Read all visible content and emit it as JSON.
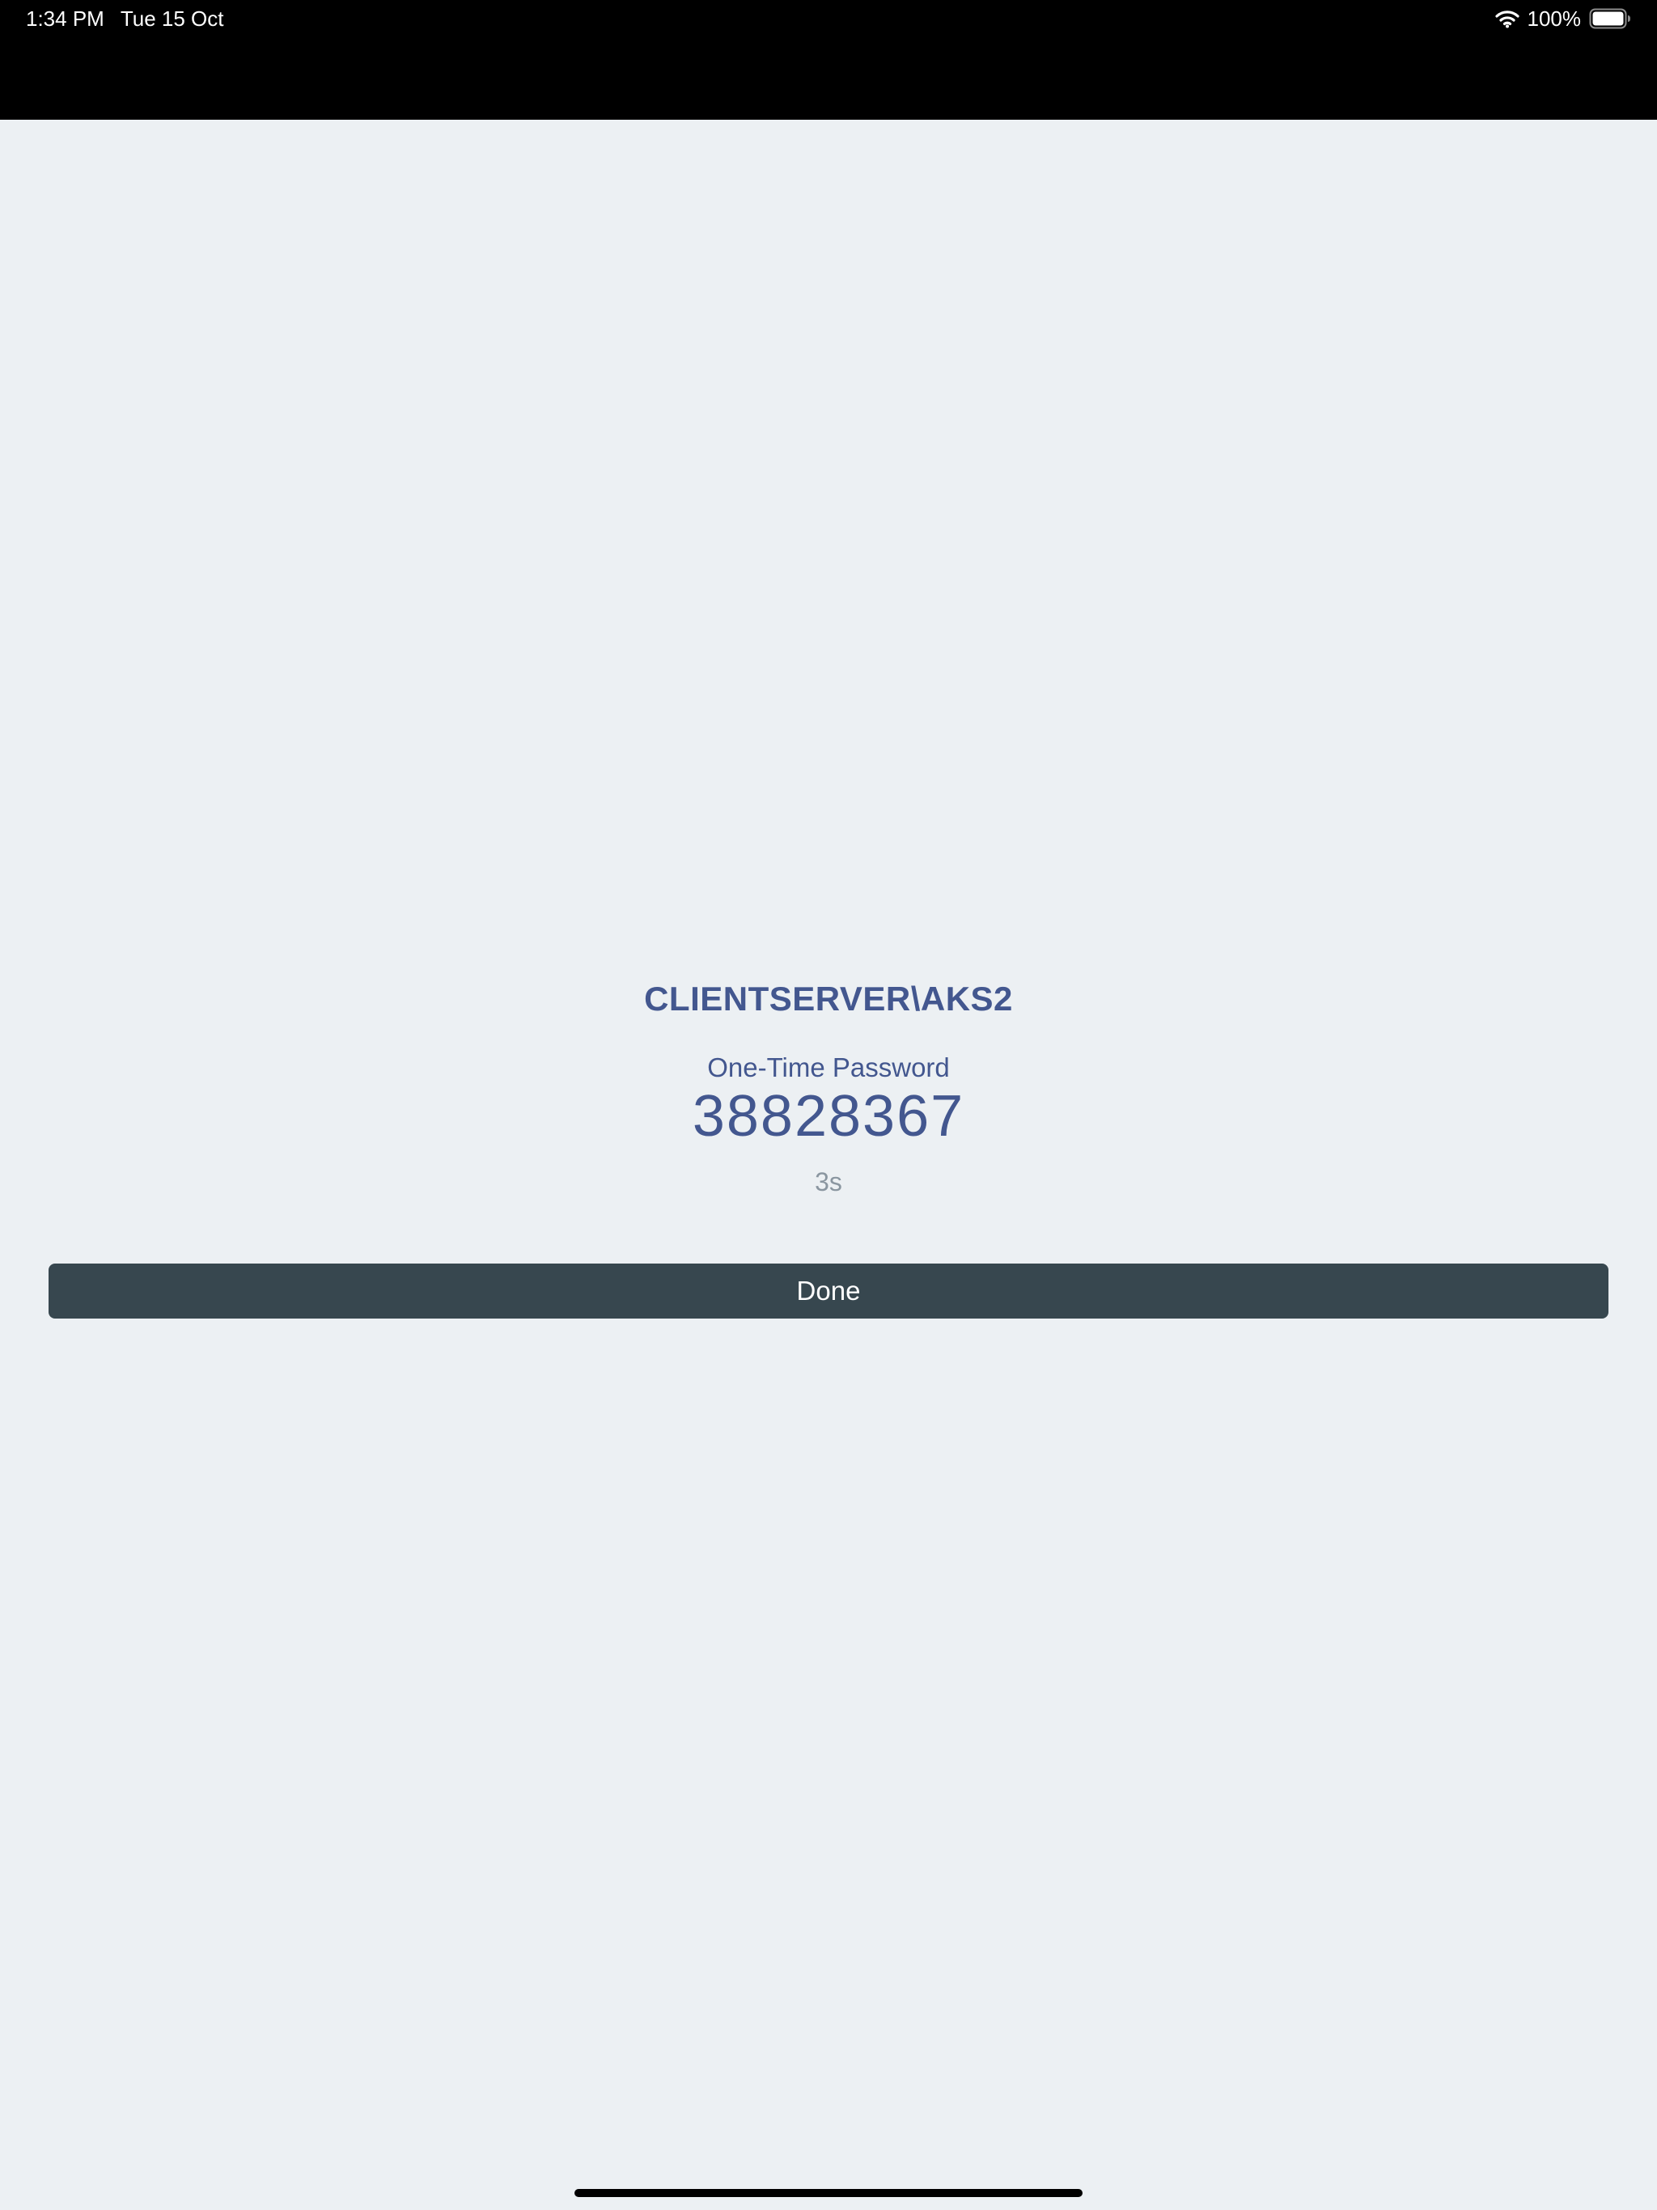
{
  "status_bar": {
    "time": "1:34 PM",
    "date": "Tue 15 Oct",
    "battery_percent": "100%",
    "battery_level": 1.0,
    "icons": [
      "wifi-icon",
      "battery-icon"
    ]
  },
  "otp": {
    "account": "CLIENTSERVER\\AKS2",
    "label": "One-Time Password",
    "code": "38828367",
    "countdown": "3s"
  },
  "actions": {
    "done_label": "Done"
  },
  "colors": {
    "background": "#ECF0F3",
    "status_bar": "#000000",
    "accent_text": "#43578F",
    "muted_text": "#8A96A0",
    "button": "#37474F",
    "button_text": "#FFFFFF"
  }
}
